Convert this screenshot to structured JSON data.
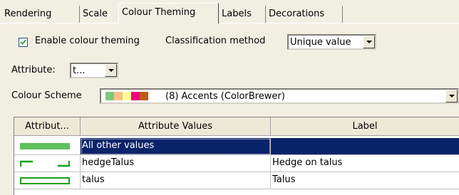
{
  "tabs": [
    {
      "label": "Rendering"
    },
    {
      "label": "Scale"
    },
    {
      "label": "Colour Theming",
      "active": true
    },
    {
      "label": "Labels"
    },
    {
      "label": "Decorations"
    }
  ],
  "theming": {
    "enable_label": "Enable colour theming",
    "enabled": true,
    "classification_label": "Classification method",
    "classification_value": "Unique value"
  },
  "attribute": {
    "label": "Attribute:",
    "value": "t..."
  },
  "scheme": {
    "label": "Colour Scheme",
    "value": "(8) Accents (ColorBrewer)",
    "swatches": [
      "#7fc97f",
      "#beaed4",
      "#fdc086",
      "#ffff99",
      "#386cb0",
      "#f0027f",
      "#bf5b17",
      "#666666"
    ]
  },
  "table": {
    "columns": [
      "Attribut...",
      "Attribute Values",
      "Label"
    ],
    "rows": [
      {
        "symbol": "fill",
        "value": "All other values",
        "label": "",
        "selected": true
      },
      {
        "symbol": "dashed",
        "value": "hedgeTalus",
        "label": "Hedge on talus",
        "selected": false
      },
      {
        "symbol": "outline",
        "value": "talus",
        "label": "Talus",
        "selected": false
      }
    ],
    "symbol_color": "#2ca02c"
  }
}
